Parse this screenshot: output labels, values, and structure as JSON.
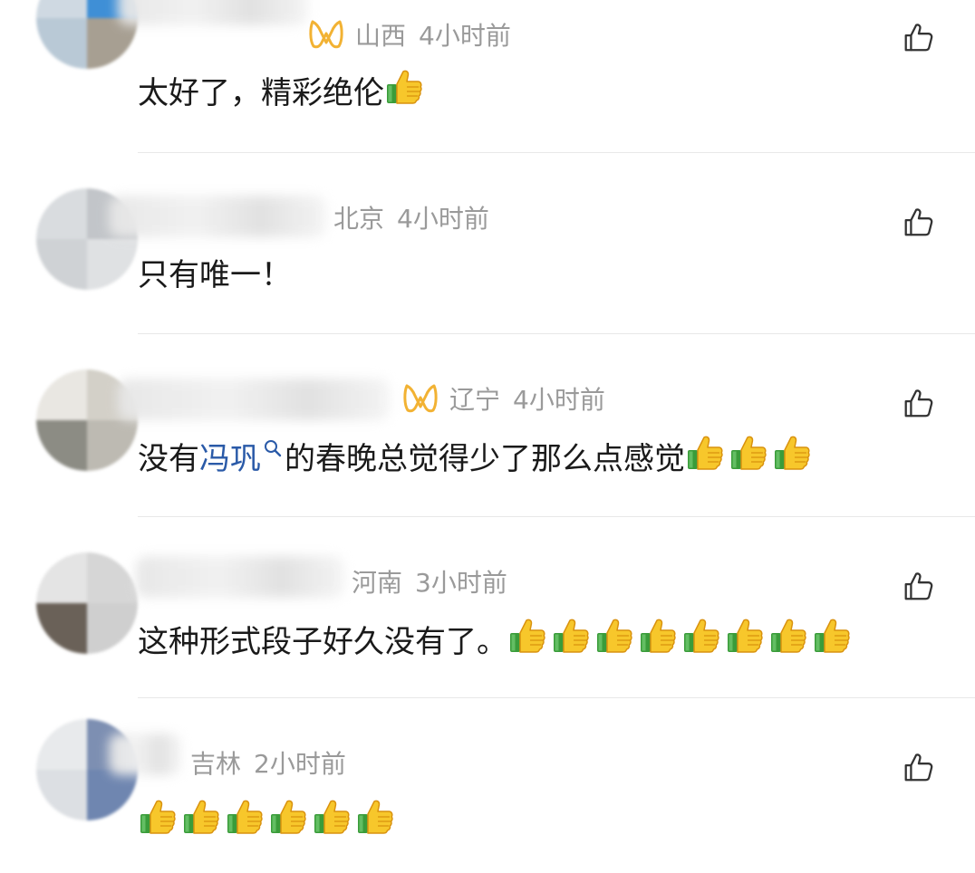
{
  "comments": [
    {
      "location": "山西",
      "time": "4小时前",
      "text": "太好了，精彩绝伦",
      "thumbs_count": 1,
      "vip": true
    },
    {
      "location": "北京",
      "time": "4小时前",
      "text": "只有唯一！",
      "thumbs_count": 0,
      "vip": false
    },
    {
      "location": "辽宁",
      "time": "4小时前",
      "text_prefix": "没有",
      "topic": "冯巩",
      "text_suffix": "的春晚总觉得少了那么点感觉",
      "thumbs_count": 3,
      "vip": true
    },
    {
      "location": "河南",
      "time": "3小时前",
      "text": "这种形式段子好久没有了。",
      "thumbs_count": 8,
      "vip": false
    },
    {
      "location": "吉林",
      "time": "2小时前",
      "text": "",
      "thumbs_count": 6,
      "vip": false
    }
  ],
  "icons": {
    "like": "thumbs-up-outline-icon",
    "emoji": "thumbs-up-emoji-icon",
    "vip": "vip-badge-icon",
    "topic_search": "search-icon"
  },
  "colors": {
    "meta_text": "#9a9a9a",
    "body_text": "#1a1a1a",
    "topic_link": "#2a5aa8",
    "vip_badge": "#f2b233",
    "divider": "#e8e8e8"
  }
}
